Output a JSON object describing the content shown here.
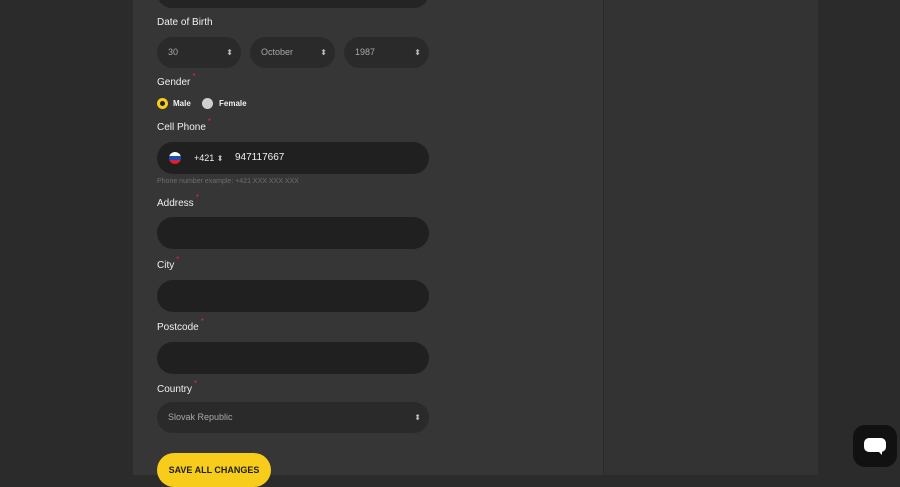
{
  "form": {
    "dob_label": "Date of Birth",
    "dob_day": "30",
    "dob_month": "October",
    "dob_year": "1987",
    "gender_label": "Gender",
    "required_mark": "*",
    "gender_male": "Male",
    "gender_female": "Female",
    "gender_selected": "Male",
    "phone_label": "Cell Phone",
    "phone_country_code": "+421",
    "phone_number": "947117667",
    "phone_hint": "Phone number example: +421 XXX XXX XXX",
    "address_label": "Address",
    "address_value": "",
    "city_label": "City",
    "city_value": "",
    "postcode_label": "Postcode",
    "postcode_value": "",
    "country_label": "Country",
    "country_value": "Slovak Republic",
    "save_label": "SAVE ALL CHANGES",
    "select_arrows": "⬍"
  },
  "colors": {
    "accent": "#f7cc1a",
    "required": "#e0245e",
    "background": "#2b2b2b",
    "panel": "#363636"
  },
  "icons": {
    "flag": "slovakia-flag-icon",
    "chat": "chat-bubble-icon"
  }
}
